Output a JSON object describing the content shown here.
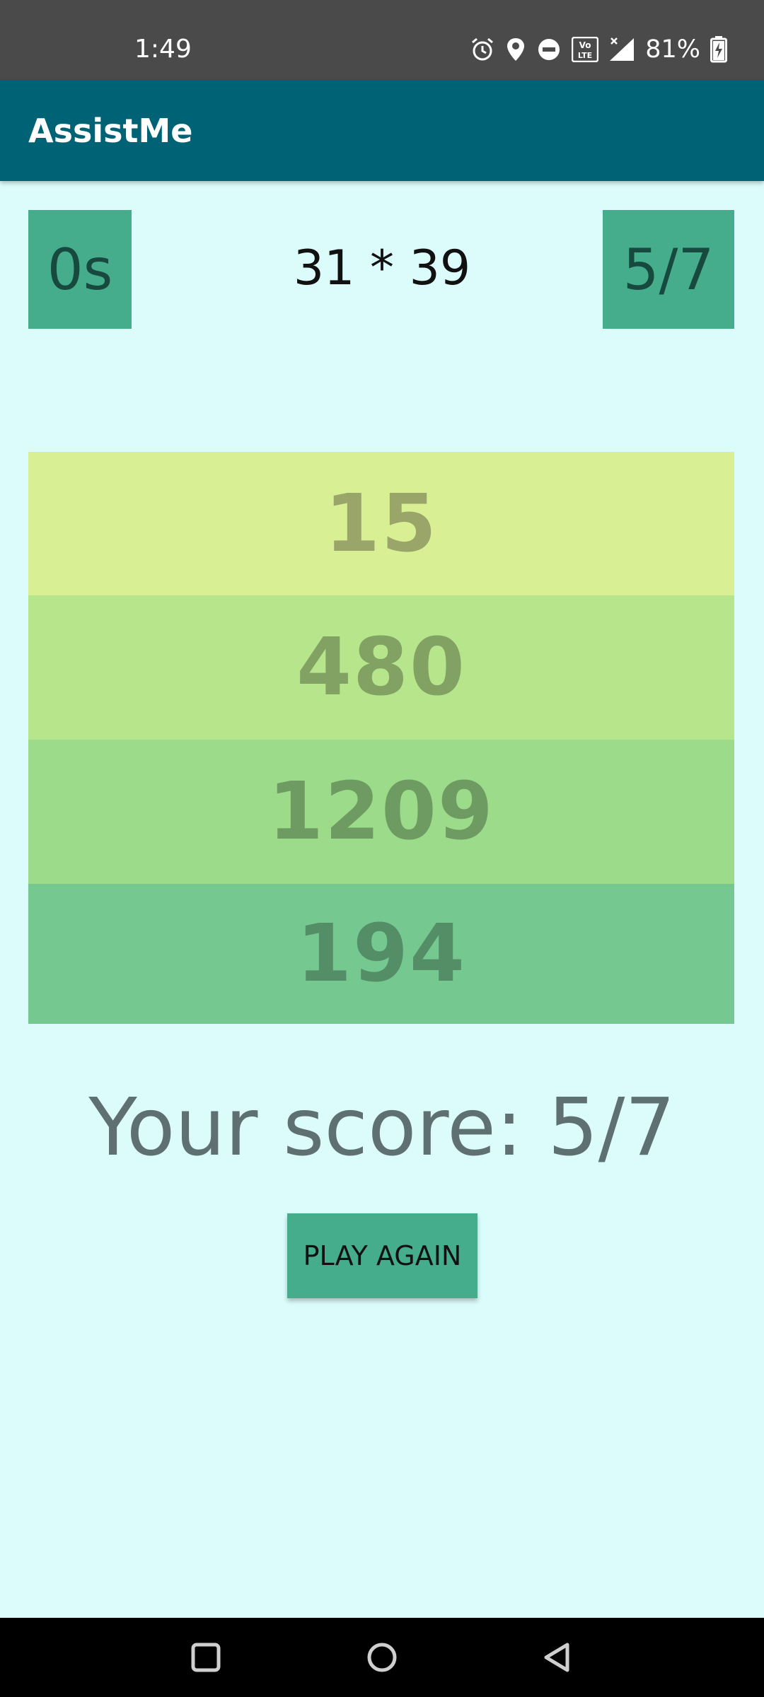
{
  "status_bar": {
    "time": "1:49",
    "battery": "81%",
    "icons": [
      "alarm-icon",
      "location-icon",
      "do-not-disturb-icon",
      "volte-icon",
      "signal-icon",
      "battery-charging-icon"
    ]
  },
  "app_bar": {
    "title": "AssistMe"
  },
  "game": {
    "timer": "0s",
    "score_badge": "5/7",
    "question": "31 * 39",
    "answers": [
      "15",
      "480",
      "1209",
      "194"
    ],
    "result_text": "Your score: 5/7",
    "play_again_label": "PLAY AGAIN"
  },
  "nav_bar": {
    "icons": [
      "recent-apps-icon",
      "home-icon",
      "back-icon"
    ]
  },
  "colors": {
    "status_bar": "#4a4a4a",
    "app_bar": "#006375",
    "background": "#dcfcfc",
    "accent": "#46ad8c"
  }
}
